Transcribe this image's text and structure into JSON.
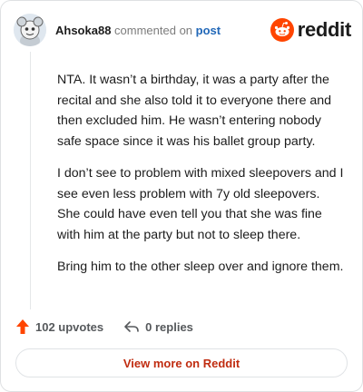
{
  "header": {
    "author": "Ahsoka88",
    "action": "commented on",
    "post_link": "post",
    "brand": "reddit",
    "avatar_icon": "snoo-avatar-icon",
    "brand_icon": "reddit-logo-icon"
  },
  "comment": {
    "paragraphs": [
      "NTA. It wasn’t a birthday, it was a party after the recital and she also told it to everyone there and then excluded him. He wasn’t entering nobody safe space since it was his ballet group party.",
      "I don’t see to problem with mixed sleepovers and I see even less problem with 7y old sleepovers. She could have even tell you that she was fine with him at the party but not to sleep there.",
      "Bring him to the other sleep over and ignore them."
    ]
  },
  "stats": {
    "upvotes": "102 upvotes",
    "replies": "0 replies",
    "upvote_icon": "upvote-arrow-icon",
    "reply_icon": "reply-arrow-icon"
  },
  "footer": {
    "view_more": "View more on Reddit"
  },
  "colors": {
    "accent": "#ff4500",
    "link": "#2268b8",
    "view_more": "#c02c10"
  }
}
